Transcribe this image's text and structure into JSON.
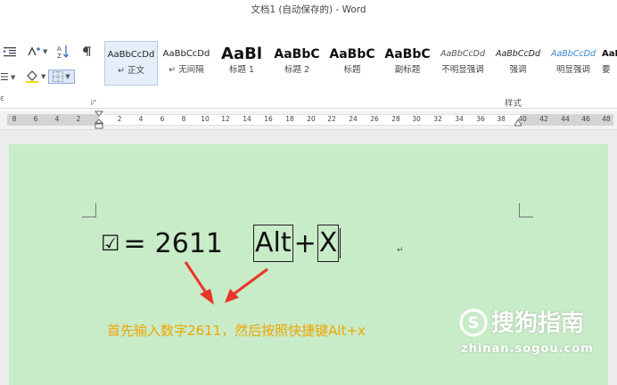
{
  "window": {
    "title": "文档1 (自动保存的) - Word"
  },
  "ribbon": {
    "group_label": "样式",
    "styles": [
      {
        "sample": "AaBbCcDd",
        "label": "↵ 正文",
        "selected": true
      },
      {
        "sample": "AaBbCcDd",
        "label": "↵ 无间隔",
        "selected": false
      },
      {
        "sample": "AaBl",
        "label": "标题 1",
        "selected": false
      },
      {
        "sample": "AaBbC",
        "label": "标题 2",
        "selected": false
      },
      {
        "sample": "AaBbC",
        "label": "标题",
        "selected": false
      },
      {
        "sample": "AaBbC",
        "label": "副标题",
        "selected": false
      },
      {
        "sample": "AaBbCcDd",
        "label": "不明显强调",
        "selected": false
      },
      {
        "sample": "AaBbCcDd",
        "label": "强调",
        "selected": false
      },
      {
        "sample": "AaBbCcDd",
        "label": "明显强调",
        "selected": false
      },
      {
        "sample": "AaBl",
        "label": "要",
        "selected": false
      }
    ]
  },
  "ruler": {
    "ticks": [
      "8",
      "6",
      "4",
      "2",
      "2",
      "4",
      "6",
      "8",
      "10",
      "12",
      "14",
      "16",
      "18",
      "20",
      "22",
      "24",
      "26",
      "28",
      "30",
      "32",
      "34",
      "36",
      "38",
      "40",
      "42",
      "44",
      "46",
      "48"
    ]
  },
  "document": {
    "checkbox_symbol": "☑",
    "equals": "=",
    "code": "2611",
    "key_alt": "Alt",
    "plus": "+",
    "key_x": "X",
    "paragraph_mark": "↵",
    "caption": "首先输入数字2611，然后按照快捷键Alt+x"
  },
  "watermark": {
    "text": "搜狗指南",
    "url": "zhinan.sogou.com"
  }
}
